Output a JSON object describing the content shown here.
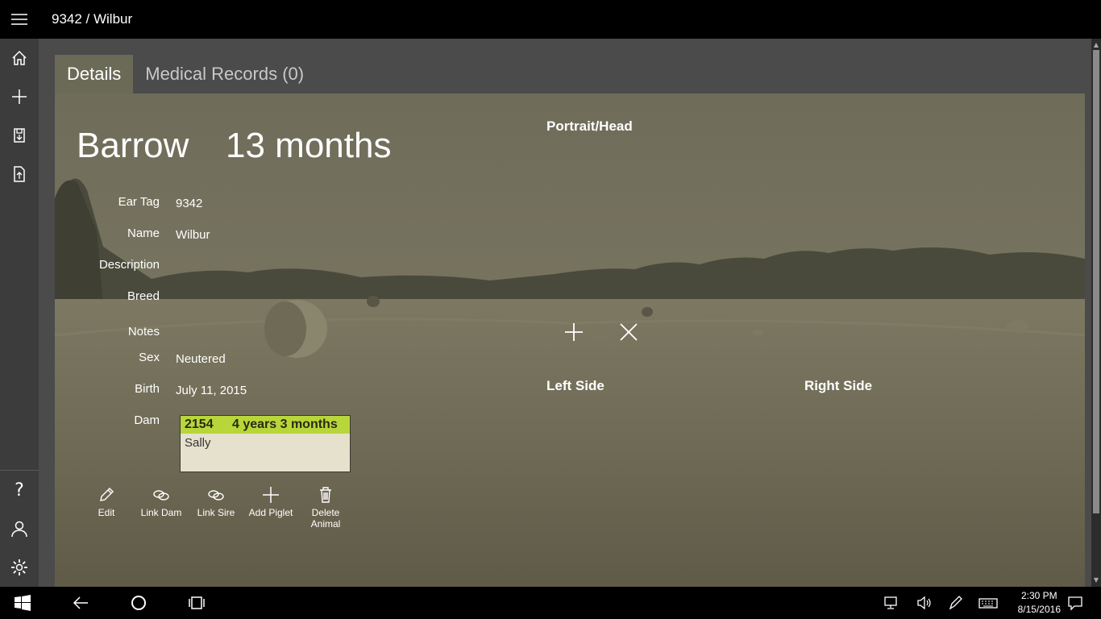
{
  "window": {
    "title": "9342 / Wilbur"
  },
  "nav": {
    "icons": [
      "hamburger-menu-icon",
      "home-icon",
      "add-icon",
      "save-icon",
      "export-icon",
      "help-icon",
      "user-icon",
      "settings-icon"
    ],
    "help_label": "?"
  },
  "tabs": [
    {
      "label": "Details",
      "active": true
    },
    {
      "label": "Medical Records (0)",
      "active": false
    }
  ],
  "animal": {
    "kind": "Barrow",
    "age": "13 months",
    "fields": [
      {
        "label": "Ear Tag",
        "value": "9342"
      },
      {
        "label": "Name",
        "value": "Wilbur"
      },
      {
        "label": "Description",
        "value": ""
      },
      {
        "label": "Breed",
        "value": ""
      },
      {
        "label": "Notes",
        "value": ""
      },
      {
        "label": "Sex",
        "value": "Neutered"
      },
      {
        "label": "Birth",
        "value": "July 11, 2015"
      },
      {
        "label": "Dam",
        "value": ""
      }
    ],
    "dam": {
      "tag": "2154",
      "age": "4 years 3 months",
      "name": "Sally",
      "header_color": "#b8d63a"
    }
  },
  "commands": [
    {
      "label": "Edit",
      "icon": "pencil-icon"
    },
    {
      "label": "Link Dam",
      "icon": "link-icon"
    },
    {
      "label": "Link Sire",
      "icon": "link-icon"
    },
    {
      "label": "Add Piglet",
      "icon": "add-icon"
    },
    {
      "label": "Delete Animal",
      "icon": "trash-icon"
    }
  ],
  "photos": {
    "portrait": "Portrait/Head",
    "left": "Left Side",
    "right": "Right Side"
  },
  "taskbar": {
    "time": "2:30 PM",
    "date": "8/15/2016"
  }
}
